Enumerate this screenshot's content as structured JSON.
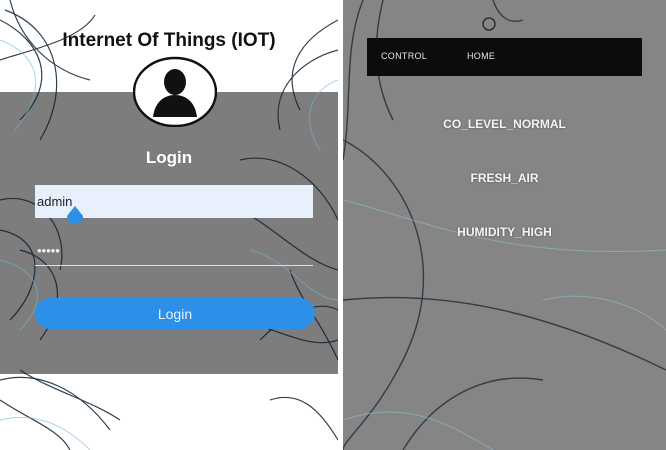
{
  "login_screen": {
    "app_title": "Internet Of Things (IOT)",
    "login_heading": "Login",
    "username": {
      "value": "admin",
      "placeholder": ""
    },
    "password": {
      "value": "•••••",
      "placeholder": ""
    },
    "login_button_label": "Login"
  },
  "dashboard_screen": {
    "nav": {
      "control_label": "CONTROL",
      "home_label": "HOME"
    },
    "status_messages": [
      "CO_LEVEL_NORMAL",
      "FRESH_AIR",
      "HUMIDITY_HIGH"
    ]
  },
  "colors": {
    "login_button": "#2c8fe8",
    "input_highlight": "#e8f0fe",
    "navbar": "#0c0c0c",
    "panel_gray": "#7d7d7d"
  },
  "icons": [
    "user-avatar-icon",
    "text-caret-handle-icon"
  ]
}
